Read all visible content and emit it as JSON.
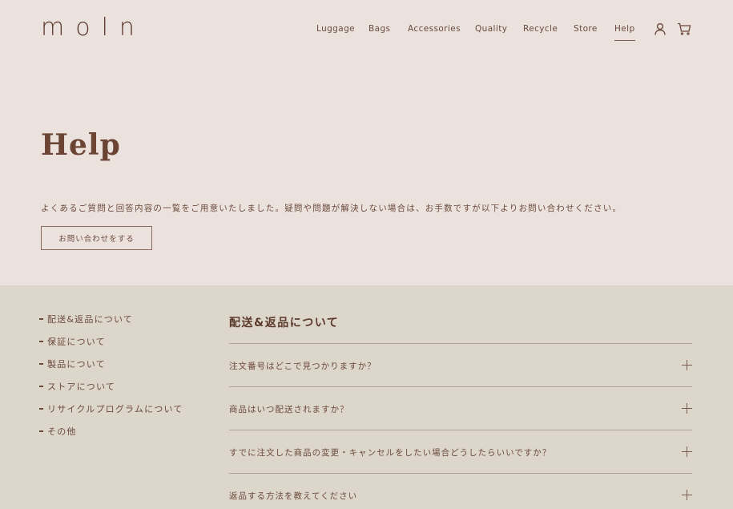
{
  "brand": {
    "logo_text": "moln"
  },
  "nav": {
    "items": [
      {
        "label": "Luggage"
      },
      {
        "label": "Bags"
      },
      {
        "label": "Accessories"
      },
      {
        "label": "Quality"
      },
      {
        "label": "Recycle"
      },
      {
        "label": "Store"
      },
      {
        "label": "Help",
        "active": true
      }
    ],
    "icons": [
      "user-icon",
      "cart-icon"
    ]
  },
  "hero": {
    "title": "Help",
    "description": "よくあるご質問と回答内容の一覧をご用意いたしました。疑問や問題が解決しない場合は、お手数ですが以下よりお問い合わせください。",
    "contact_button": "お問い合わせをする"
  },
  "sidebar": {
    "items": [
      {
        "label": "配送&返品について"
      },
      {
        "label": "保証について"
      },
      {
        "label": "製品について"
      },
      {
        "label": "ストアについて"
      },
      {
        "label": "リサイクルプログラムについて"
      },
      {
        "label": "その他"
      }
    ]
  },
  "faq": {
    "section_title": "配送&返品について",
    "questions": [
      {
        "q": "注文番号はどこで見つかりますか？"
      },
      {
        "q": "商品はいつ配送されますか？"
      },
      {
        "q": "すでに注文した商品の変更・キャンセルをしたい場合どうしたらいいですか？"
      },
      {
        "q": "返品する方法を教えてください"
      }
    ]
  },
  "colors": {
    "background": "#ebe2de",
    "lower_background": "#ddd6cb",
    "text": "#5b3a2c"
  }
}
